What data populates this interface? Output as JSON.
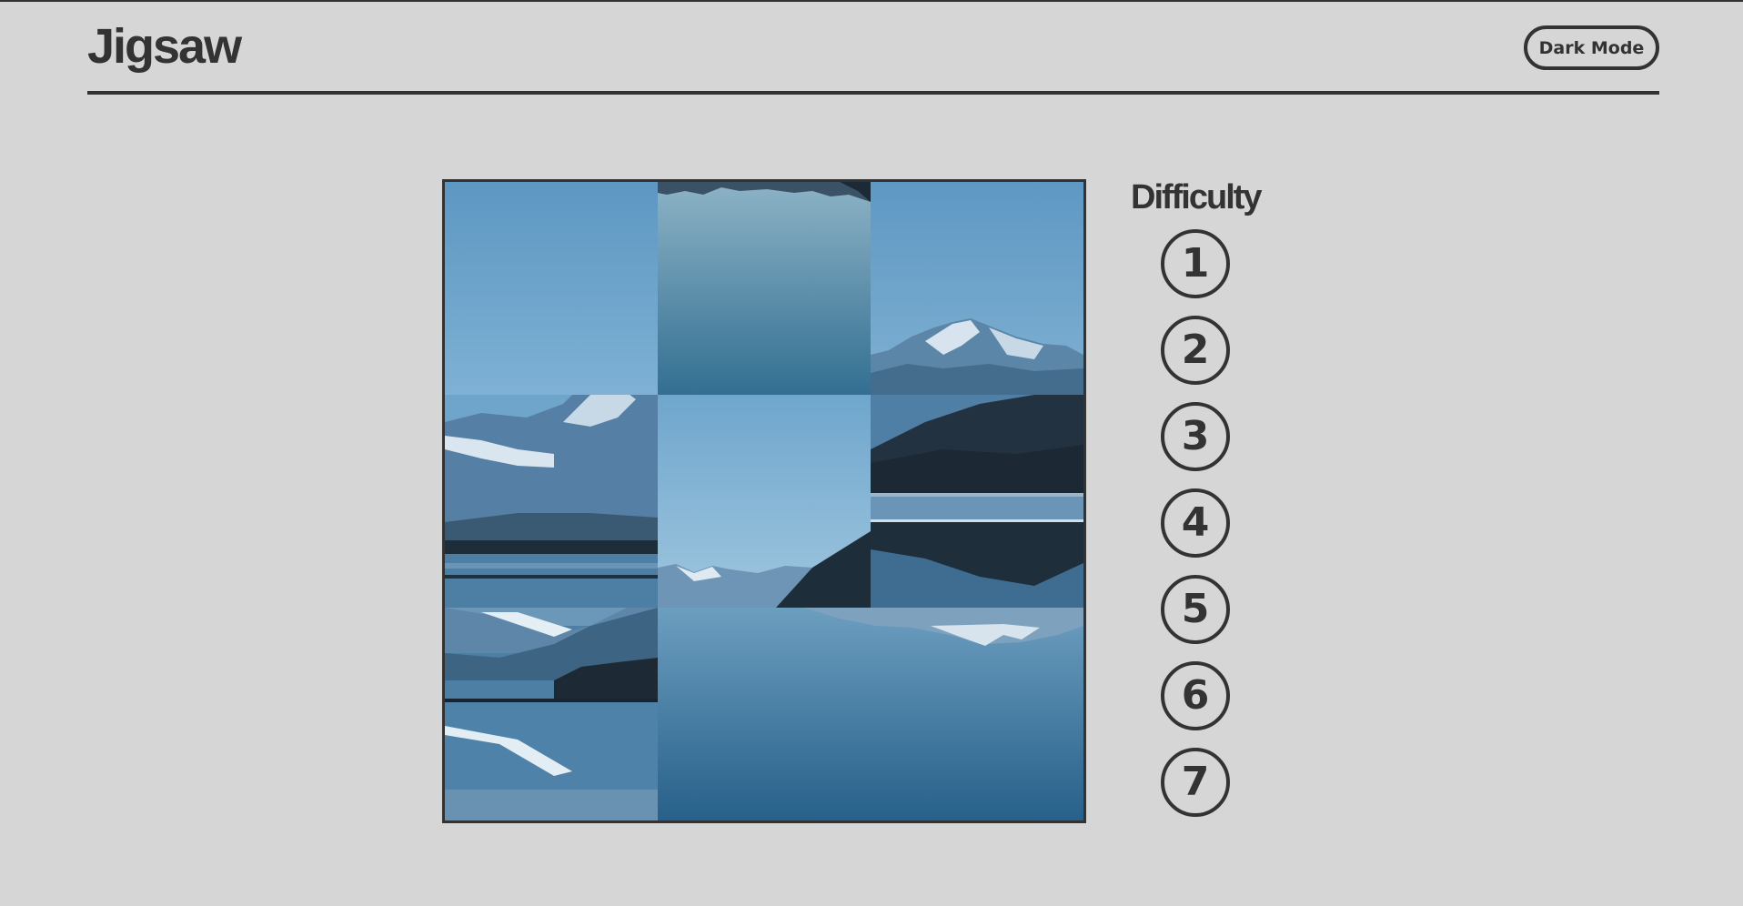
{
  "header": {
    "title": "Jigsaw",
    "dark_mode_label": "Dark Mode"
  },
  "puzzle": {
    "image": "mountain-lake-reflection",
    "grid": [
      3,
      3
    ],
    "tiles": [
      {
        "piece": "sky-empty"
      },
      {
        "piece": "water-reflection-top"
      },
      {
        "piece": "mountain-peak-right"
      },
      {
        "piece": "mountain-left-snow"
      },
      {
        "piece": "sky-with-distant-mountains"
      },
      {
        "piece": "dark-hillside-right"
      },
      {
        "piece": "reflection-hills-left"
      },
      {
        "piece": "water-deep-center"
      },
      {
        "piece": "water-reflection-right"
      }
    ]
  },
  "difficulty": {
    "label": "Difficulty",
    "levels": [
      "1",
      "2",
      "3",
      "4",
      "5",
      "6",
      "7"
    ]
  }
}
